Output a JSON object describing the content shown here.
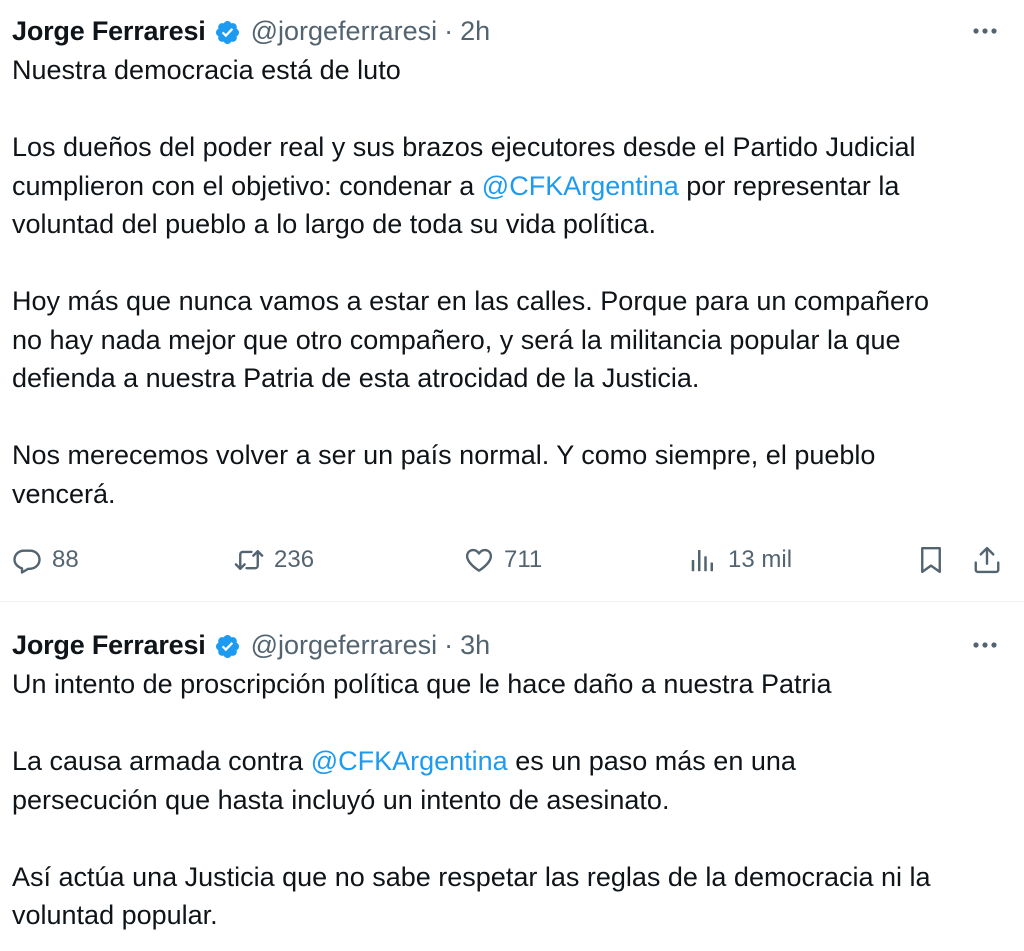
{
  "tweets": [
    {
      "author": {
        "name": "Jorge Ferraresi",
        "handle": "@jorgeferraresi",
        "verified": true
      },
      "separator": "·",
      "time": "2h",
      "lines": {
        "l1": "Nuestra democracia está de luto",
        "l2": "Los dueños del poder real y sus brazos ejecutores desde el Partido Judicial",
        "l3_before": "cumplieron con el objetivo: condenar a ",
        "l3_mention": "@CFKArgentina",
        "l3_after": " por representar la",
        "l4": "voluntad del pueblo a lo largo de toda su vida política.",
        "l5": "Hoy más que nunca vamos a estar en las calles. Porque para un compañero",
        "l6": "no hay nada mejor que otro compañero, y será la militancia popular la que",
        "l7": "defienda a nuestra Patria de esta atrocidad de la Justicia.",
        "l8": "Nos merecemos volver a ser un país normal. Y como siempre, el pueblo",
        "l9": "vencerá."
      },
      "actions": {
        "replies": "88",
        "retweets": "236",
        "likes": "711",
        "views": "13 mil"
      }
    },
    {
      "author": {
        "name": "Jorge Ferraresi",
        "handle": "@jorgeferraresi",
        "verified": true
      },
      "separator": "·",
      "time": "3h",
      "lines": {
        "l1": "Un intento de proscripción política que le hace daño a nuestra Patria",
        "l2_before": "La causa armada contra ",
        "l2_mention": "@CFKArgentina",
        "l2_after": " es un paso más en una",
        "l3": "persecución que hasta incluyó un intento de asesinato.",
        "l4": "Así actúa una Justicia que no sabe respetar las reglas de la democracia ni la",
        "l5": "voluntad popular."
      }
    }
  ],
  "icons": {
    "verified": "verified-badge-icon",
    "more": "more-options-icon",
    "reply": "reply-icon",
    "retweet": "retweet-icon",
    "like": "like-icon",
    "views": "views-icon",
    "bookmark": "bookmark-icon",
    "share": "share-icon"
  },
  "colors": {
    "text": "#0f1419",
    "secondary": "#536471",
    "mention": "#1d9bf0",
    "verified": "#1d9bf0",
    "divider": "#eff3f4"
  }
}
